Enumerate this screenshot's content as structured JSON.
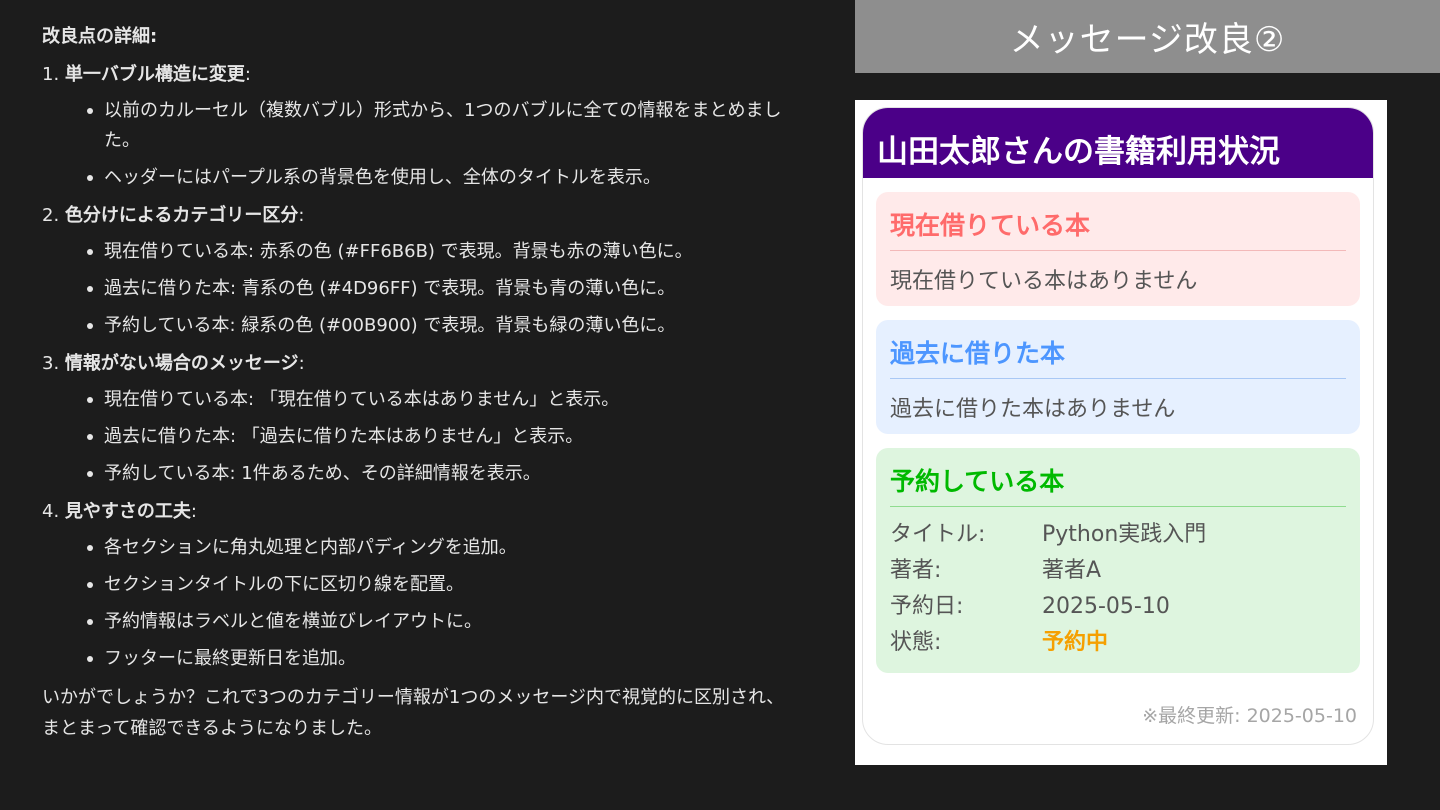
{
  "left": {
    "intro": "改良点の詳細:",
    "sections": [
      {
        "num": "1.",
        "title": "単一バブル構造に変更",
        "colon": ":",
        "items": [
          "以前のカルーセル（複数バブル）形式から、1つのバブルに全ての情報をまとめました。",
          "ヘッダーにはパープル系の背景色を使用し、全体のタイトルを表示。"
        ]
      },
      {
        "num": "2.",
        "title": "色分けによるカテゴリー区分",
        "colon": ":",
        "items": [
          "現在借りている本: 赤系の色 (#FF6B6B) で表現。背景も赤の薄い色に。",
          "過去に借りた本: 青系の色 (#4D96FF) で表現。背景も青の薄い色に。",
          "予約している本: 緑系の色 (#00B900) で表現。背景も緑の薄い色に。"
        ]
      },
      {
        "num": "3.",
        "title": "情報がない場合のメッセージ",
        "colon": ":",
        "items": [
          "現在借りている本: 「現在借りている本はありません」と表示。",
          "過去に借りた本: 「過去に借りた本はありません」と表示。",
          "予約している本: 1件あるため、その詳細情報を表示。"
        ]
      },
      {
        "num": "4.",
        "title": "見やすさの工夫",
        "colon": ":",
        "items": [
          "各セクションに角丸処理と内部パディングを追加。",
          "セクションタイトルの下に区切り線を配置。",
          "予約情報はラベルと値を横並びレイアウトに。",
          "フッターに最終更新日を追加。"
        ]
      }
    ],
    "outro": "いかがでしょうか？これで3つのカテゴリー情報が1つのメッセージ内で視覚的に区別され、まとまって確認できるようになりました。"
  },
  "slide": {
    "title": "メッセージ改良②"
  },
  "card": {
    "header": "山田太郎さんの書籍利用状況",
    "current": {
      "title": "現在借りている本",
      "body": "現在借りている本はありません"
    },
    "past": {
      "title": "過去に借りた本",
      "body": "過去に借りた本はありません"
    },
    "reserved": {
      "title": "予約している本",
      "rows": [
        {
          "label": "タイトル:",
          "value": "Python実践入門"
        },
        {
          "label": "著者:",
          "value": "著者A"
        },
        {
          "label": "予約日:",
          "value": "2025-05-10"
        },
        {
          "label": "状態:",
          "value": "予約中"
        }
      ]
    },
    "footer": "※最終更新: 2025-05-10"
  },
  "colors": {
    "header_purple": "#4B0088",
    "current_red": "#FF6B6B",
    "past_blue": "#4D96FF",
    "reserved_green": "#00B900",
    "status_orange": "#F5A000"
  }
}
